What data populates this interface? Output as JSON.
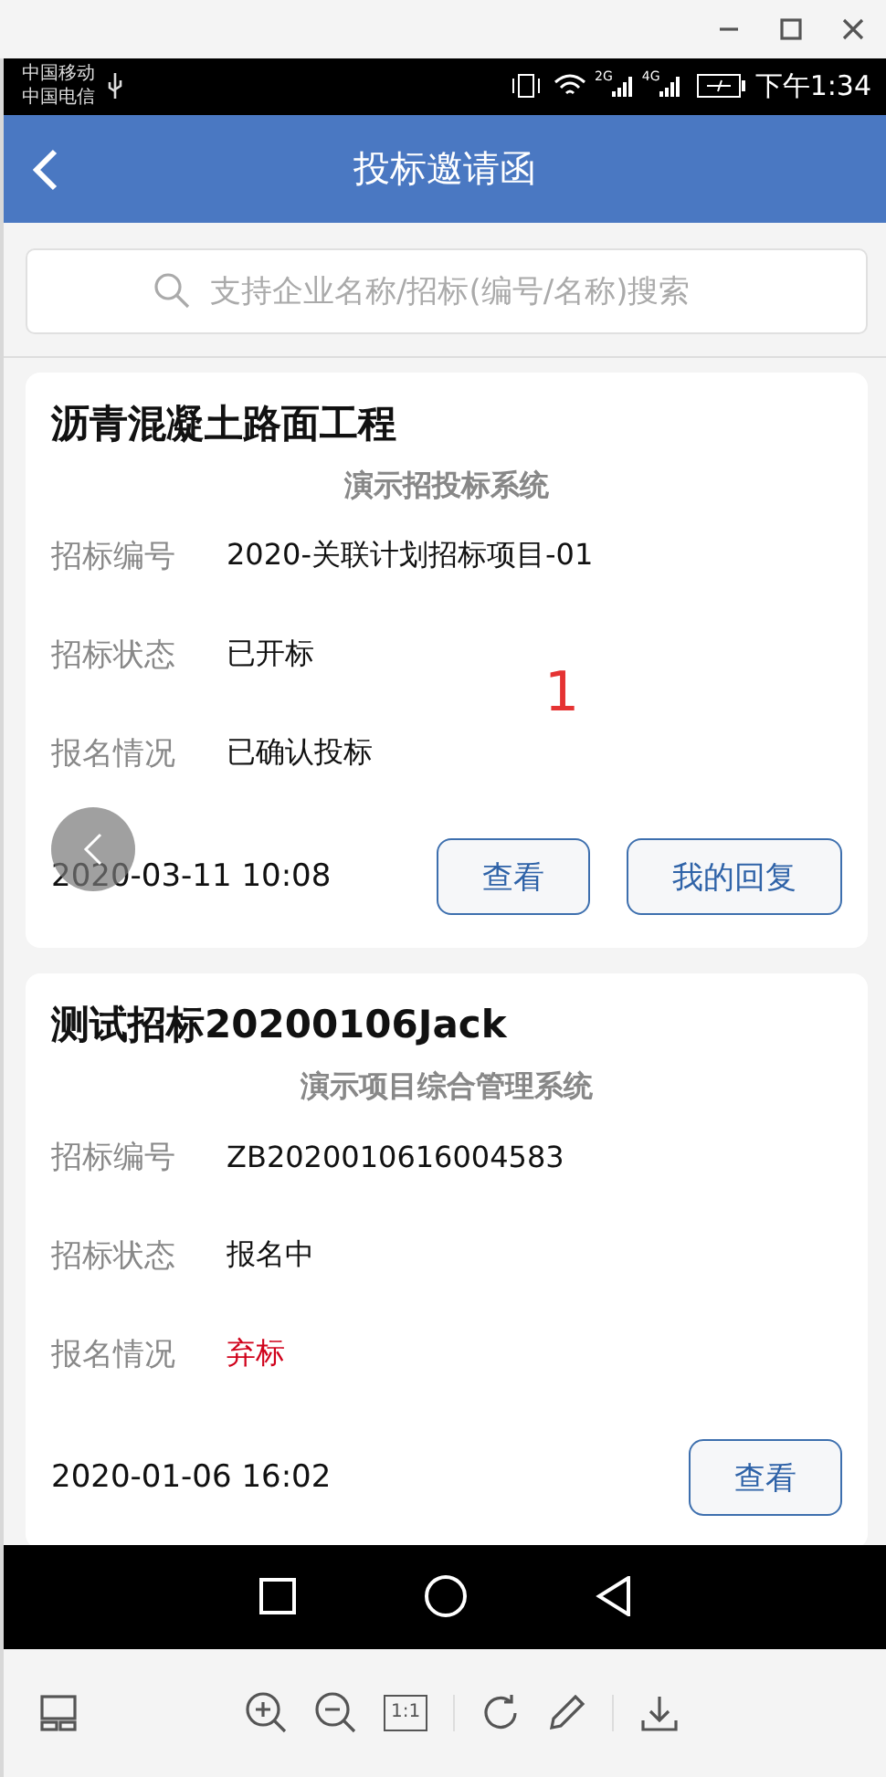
{
  "status_bar": {
    "carriers": [
      "中国移动",
      "中国电信"
    ],
    "signals": [
      "2G",
      "4G"
    ],
    "time": "下午1:34"
  },
  "header": {
    "title": "投标邀请函"
  },
  "search": {
    "placeholder": "支持企业名称/招标(编号/名称)搜索"
  },
  "cards": [
    {
      "title": "沥青混凝土路面工程",
      "system": "演示招投标系统",
      "fields": [
        {
          "label": "招标编号",
          "value": "2020-关联计划招标项目-01",
          "kind": "normal"
        },
        {
          "label": "招标状态",
          "value": "已开标",
          "kind": "normal"
        },
        {
          "label": "报名情况",
          "value": "已确认投标",
          "kind": "normal"
        }
      ],
      "date": "2020-03-11 10:08",
      "buttons": [
        "查看",
        "我的回复"
      ]
    },
    {
      "title": "测试招标20200106Jack",
      "system": "演示项目综合管理系统",
      "fields": [
        {
          "label": "招标编号",
          "value": "ZB2020010616004583",
          "kind": "normal"
        },
        {
          "label": "招标状态",
          "value": "报名中",
          "kind": "normal"
        },
        {
          "label": "报名情况",
          "value": "弃标",
          "kind": "alert"
        }
      ],
      "date": "2020-01-06 16:02",
      "buttons": [
        "查看"
      ]
    }
  ],
  "overlay_number": "1",
  "toolbar": {
    "actual_size": "1:1"
  }
}
